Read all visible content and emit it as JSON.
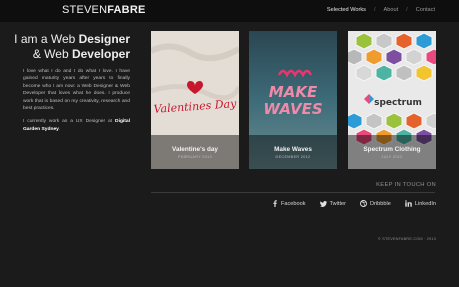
{
  "header": {
    "logo_part1": "STEVEN",
    "logo_part2": "FABRE",
    "nav": [
      "Selected Works",
      "About",
      "Contact"
    ],
    "nav_separator": "/"
  },
  "intro": {
    "title_line1_pre": "I am a Web ",
    "title_line1_bold": "Designer",
    "title_line2_pre": "& Web ",
    "title_line2_bold": "Developer",
    "paragraph1": "I love what I do and I do what I love. I have gained maturity years after years to finally become who I am now: a Web Designer & Web Developer that loves what he does. I produce work that is based on my creativity, research and best practices.",
    "paragraph2_pre": "I currently work as a UX Designer at ",
    "paragraph2_link": "Digital Garden Sydney",
    "paragraph2_post": "."
  },
  "works": [
    {
      "title": "Valentine's day",
      "date": "FEBRUARY 2013",
      "art_text": "Valentines Day",
      "icon": "heart-icon"
    },
    {
      "title": "Make Waves",
      "date": "DECEMBER 2012",
      "art_text_line1": "MAKE",
      "art_text_line2": "WAVES",
      "icon": "wave-icon"
    },
    {
      "title": "Spectrum Clothing",
      "date": "JULY 2012",
      "art_text": "spectrum",
      "icon": "spectrum-logo-icon"
    }
  ],
  "contact": {
    "heading": "KEEP IN TOUCH ON",
    "links": [
      {
        "label": "Facebook",
        "icon": "facebook-icon"
      },
      {
        "label": "Twitter",
        "icon": "twitter-icon"
      },
      {
        "label": "Dribbble",
        "icon": "dribbble-icon"
      },
      {
        "label": "LinkedIn",
        "icon": "linkedin-icon"
      }
    ]
  },
  "footer": {
    "copyright": "© STEVENFABRE.COM · 2013"
  },
  "colors": {
    "background": "#1b1b1b",
    "header": "#0e0e0e",
    "text": "#cfcfcf",
    "accent": "#ffffff"
  }
}
